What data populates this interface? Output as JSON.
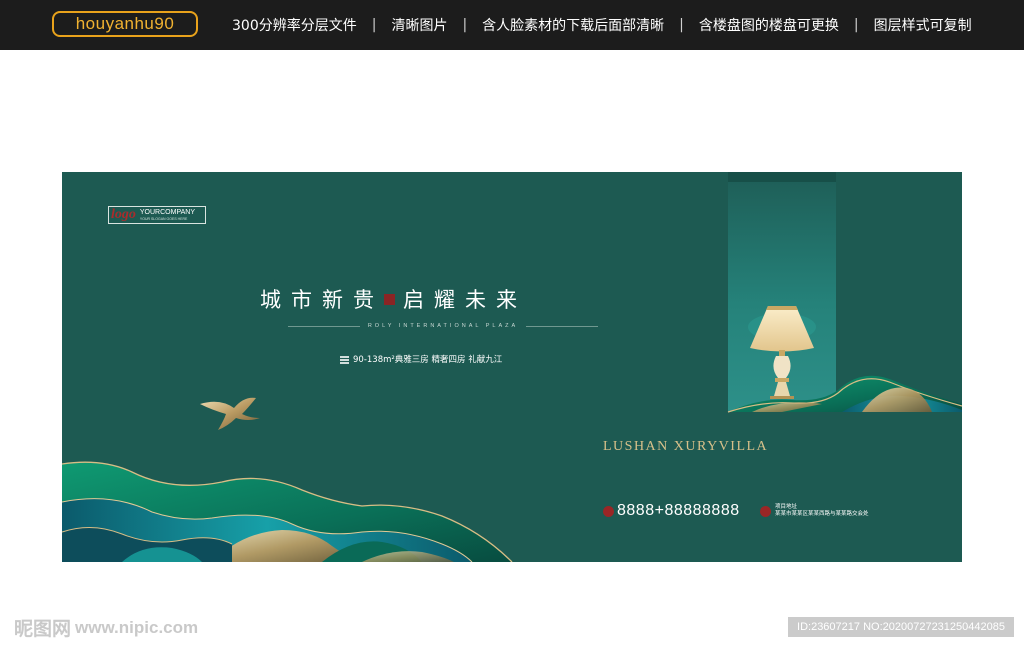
{
  "header": {
    "brand": "houyanhu90",
    "features": [
      "300分辨率分层文件",
      "清晰图片",
      "含人脸素材的下载后面部清晰",
      "含楼盘图的楼盘可更换",
      "图层样式可复制"
    ],
    "separator": "|"
  },
  "banner": {
    "logo": {
      "mark": "logo",
      "company": "YOURCOMPANY",
      "slogan": "YOUR SLOGAN GOES HERE"
    },
    "headline_left": "城市新贵",
    "headline_right": "启耀未来",
    "subtitle_en": "ROLY INTERNATIONAL PLAZA",
    "tagline": "90-138m²典雅三房 精奢四房 礼献九江",
    "title_en": "LUSHAN XURYVILLA",
    "phone": "8888+88888888",
    "address_label": "项目地址",
    "address_value": "某某市某某区某某西路与某某路交会处",
    "colors": {
      "background": "#1d5a52",
      "gold": "#d7c08a",
      "seal_red": "#9a2626",
      "emerald": "#0d8a6a",
      "teal_blue": "#136e86"
    }
  },
  "watermark": {
    "site_name": "昵图网",
    "site_url": "www.nipic.com",
    "id_text": "ID:23607217 NO:20200727231250442085"
  },
  "icons": [
    "phone-icon",
    "location-icon",
    "lamp-illustration",
    "bird-illustration",
    "wave-mountains"
  ]
}
